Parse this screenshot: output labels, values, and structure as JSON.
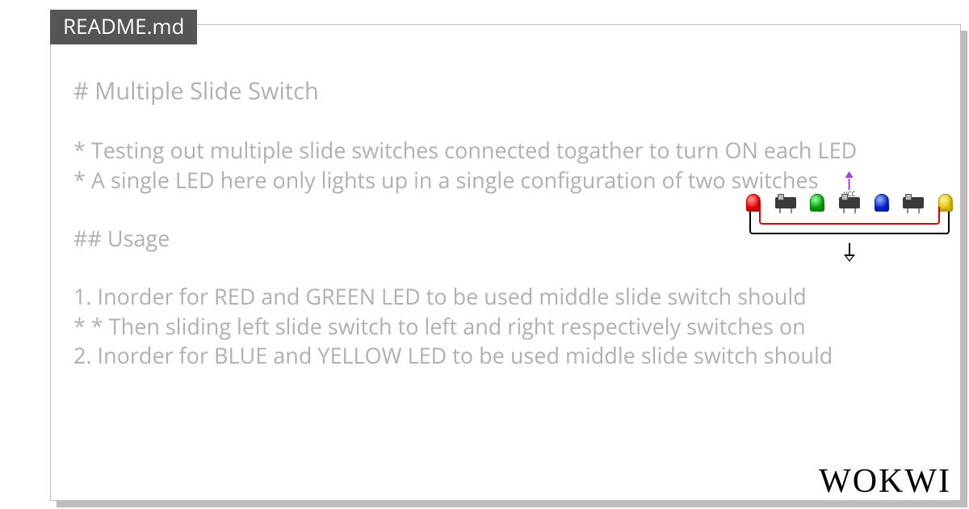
{
  "tab_label": "README.md",
  "brand": "WOKWI",
  "doc": {
    "h1": "# Multiple Slide Switch",
    "bullets": [
      "* Testing out multiple slide switches connected togather to turn ON each LED",
      "* A single LED here only lights up in a single configuration of two switches"
    ],
    "h2": "## Usage",
    "steps": [
      "1. Inorder for RED and GREEN LED to be used middle slide switch should",
      "*  * Then sliding left slide switch to left and right respectively switches on",
      "2. Inorder for BLUE and YELLOW LED to be used middle slide switch should"
    ]
  },
  "diagram": {
    "vcc_label": "VCC",
    "components": [
      "led-red",
      "switch",
      "led-green",
      "switch",
      "led-blue",
      "switch",
      "led-yellow"
    ]
  }
}
